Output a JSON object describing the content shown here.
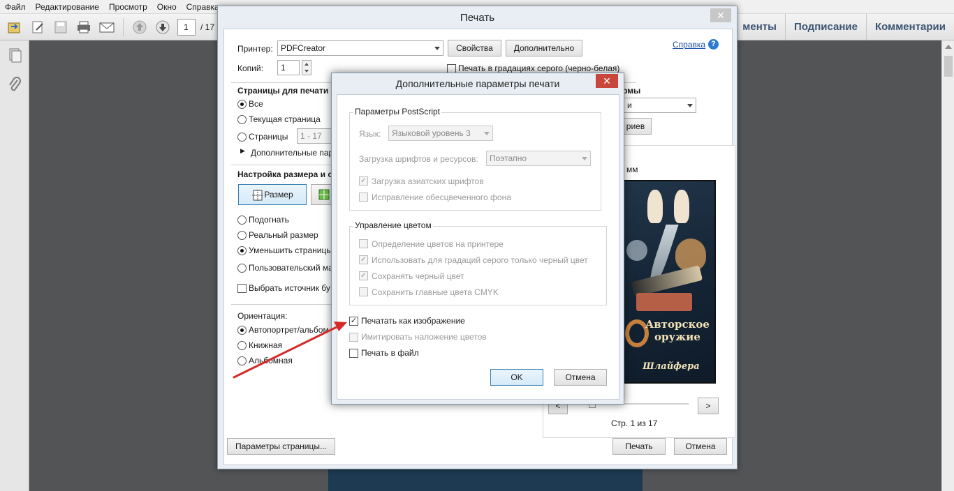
{
  "menu": [
    "Файл",
    "Редактирование",
    "Просмотр",
    "Окно",
    "Справка"
  ],
  "toolbar": {
    "page_current": "1",
    "page_total": "/ 17"
  },
  "right_tabs": [
    "менты",
    "Подписание",
    "Комментарии"
  ],
  "print_dialog": {
    "title": "Печать",
    "close_glyph": "✕",
    "printer_label": "Принтер:",
    "printer_value": "PDFCreator",
    "properties_button": "Свойства",
    "advanced_button": "Дополнительно",
    "help_link": "Справка",
    "copies_label": "Копий:",
    "copies_value": "1",
    "grayscale_label": "Печать в градациях серого (черно-белая)",
    "pages_section": "Страницы для печати",
    "pages_options": [
      "Все",
      "Текущая страница",
      "Страницы"
    ],
    "pages_range_value": "1 - 17",
    "more_options": "Дополнительные пар",
    "size_section": "Настройка размера и об",
    "size_button": "Размер",
    "fit_options": [
      "Подогнать",
      "Реальный размер",
      "Уменьшить страницы",
      "Пользовательский ма"
    ],
    "paper_source_label": "Выбрать источник бу",
    "orientation_label": "Ориентация:",
    "orientation_options": [
      "Автопортрет/альбом",
      "Книжная",
      "Альбомная"
    ],
    "forms_section_fragment": "рмы",
    "forms_select_fragment": "и",
    "summary_button_fragment": "риев",
    "mm_label": "мм",
    "cover_title": "Авторское оружие",
    "cover_author": "Шлайфера",
    "prev_button": "<",
    "next_button": ">",
    "page_indicator": "Стр. 1 из 17",
    "page_setup_button": "Параметры страницы...",
    "print_button": "Печать",
    "cancel_button": "Отмена"
  },
  "advanced_dialog": {
    "title": "Дополнительные параметры печати",
    "close_glyph": "✕",
    "postscript_group": "Параметры PostScript",
    "language_label": "Язык:",
    "language_value": "Языковой уровень 3",
    "font_download_label": "Загрузка шрифтов и ресурсов:",
    "font_download_value": "Поэтапно",
    "asian_fonts": "Загрузка азиатских шрифтов",
    "bg_fix": "Исправление обесцвеченного фона",
    "color_group": "Управление цветом",
    "color_printer": "Определение цветов на принтере",
    "black_for_gray": "Использовать для градаций серого только черный цвет",
    "keep_black": "Сохранять черный цвет",
    "keep_cmyk": "Сохранить главные цвета CMYK",
    "print_as_image": "Печатать как изображение",
    "simulate_overprint": "Имитировать наложение цветов",
    "print_to_file": "Печать в файл",
    "ok_button": "OK",
    "cancel_button": "Отмена"
  },
  "colors": {
    "arrow": "#d42a2a",
    "close_red": "#c9463d",
    "link_blue": "#1d4fa6"
  }
}
